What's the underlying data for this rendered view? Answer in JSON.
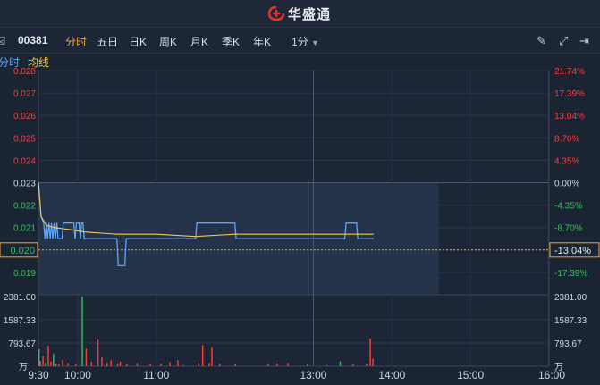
{
  "brand": {
    "name": "华盛通"
  },
  "toolbar": {
    "code": "00381",
    "tabs": [
      "分时",
      "五日",
      "日K",
      "周K",
      "月K",
      "季K",
      "年K"
    ],
    "active_tab": "分时",
    "interval": "1分"
  },
  "legend": {
    "minute": "分时",
    "avg": "均线"
  },
  "colors": {
    "up": "#ff3d3d",
    "down": "#2ec55a",
    "price_line": "#5aa6ff",
    "avg_line": "#f2c94c",
    "accent": "#f2a53b"
  },
  "price_axis": {
    "left_up": [
      "0.028",
      "0.027",
      "0.026",
      "0.025",
      "0.024"
    ],
    "left_ref": "0.023",
    "left_down": [
      "0.022",
      "0.021",
      "0.020",
      "0.019"
    ],
    "right_up": [
      "21.74%",
      "17.39%",
      "13.04%",
      "8.70%",
      "4.35%"
    ],
    "right_ref": "0.00%",
    "right_down": [
      "-4.35%",
      "-8.70%",
      "-13.04%",
      "-17.39%"
    ],
    "current_price": "0.020",
    "current_pct": "-13.04%"
  },
  "volume_axis": {
    "labels": [
      "2381.00",
      "1587.33",
      "793.67"
    ],
    "unit": "万"
  },
  "time_axis": {
    "labels": [
      "9:30",
      "10:00",
      "11:00",
      "13:00",
      "14:00",
      "15:00",
      "16:00"
    ]
  },
  "chart_data": {
    "type": "line",
    "session_minutes": 390,
    "current_minute": 306,
    "price_ylim": [
      0.018,
      0.028
    ],
    "ref_price": 0.023,
    "price": [
      [
        0,
        0.023
      ],
      [
        1,
        0.0223
      ],
      [
        2,
        0.0215
      ],
      [
        4,
        0.0212
      ],
      [
        5,
        0.0205
      ],
      [
        6,
        0.0212
      ],
      [
        7,
        0.0205
      ],
      [
        8,
        0.0212
      ],
      [
        9,
        0.0205
      ],
      [
        10,
        0.0212
      ],
      [
        11,
        0.0205
      ],
      [
        12,
        0.0212
      ],
      [
        13,
        0.0205
      ],
      [
        14,
        0.0212
      ],
      [
        15,
        0.0205
      ],
      [
        18,
        0.0205
      ],
      [
        19,
        0.0212
      ],
      [
        27,
        0.0212
      ],
      [
        28,
        0.0205
      ],
      [
        29,
        0.0212
      ],
      [
        31,
        0.0212
      ],
      [
        32,
        0.0205
      ],
      [
        33,
        0.0212
      ],
      [
        34,
        0.0212
      ],
      [
        35,
        0.0205
      ],
      [
        60,
        0.0205
      ],
      [
        61,
        0.0193
      ],
      [
        66,
        0.0193
      ],
      [
        67,
        0.0205
      ],
      [
        120,
        0.0205
      ],
      [
        121,
        0.0212
      ],
      [
        150,
        0.0212
      ],
      [
        151,
        0.0205
      ],
      [
        234,
        0.0205
      ],
      [
        235,
        0.0212
      ],
      [
        243,
        0.0212
      ],
      [
        244,
        0.0205
      ],
      [
        256,
        0.0205
      ]
    ],
    "avg": [
      [
        0,
        0.023
      ],
      [
        2,
        0.0215
      ],
      [
        6,
        0.0211
      ],
      [
        12,
        0.021
      ],
      [
        25,
        0.0209
      ],
      [
        35,
        0.0208
      ],
      [
        60,
        0.0207
      ],
      [
        90,
        0.0207
      ],
      [
        120,
        0.0206
      ],
      [
        150,
        0.0207
      ],
      [
        180,
        0.0207
      ],
      [
        210,
        0.0207
      ],
      [
        240,
        0.0207
      ],
      [
        256,
        0.0207
      ]
    ],
    "volume_ylim": [
      0,
      2381
    ],
    "volume": [
      [
        0,
        580,
        "down"
      ],
      [
        1,
        180,
        "up"
      ],
      [
        3,
        350,
        "up"
      ],
      [
        5,
        120,
        "down"
      ],
      [
        7,
        700,
        "up"
      ],
      [
        9,
        160,
        "up"
      ],
      [
        11,
        420,
        "down"
      ],
      [
        13,
        90,
        "up"
      ],
      [
        15,
        60,
        "up"
      ],
      [
        18,
        220,
        "up"
      ],
      [
        22,
        110,
        "up"
      ],
      [
        28,
        70,
        "up"
      ],
      [
        33,
        2381,
        "down"
      ],
      [
        36,
        600,
        "up"
      ],
      [
        40,
        150,
        "up"
      ],
      [
        45,
        900,
        "up"
      ],
      [
        48,
        300,
        "up"
      ],
      [
        52,
        120,
        "up"
      ],
      [
        55,
        200,
        "up"
      ],
      [
        60,
        90,
        "up"
      ],
      [
        62,
        160,
        "up"
      ],
      [
        67,
        70,
        "up"
      ],
      [
        75,
        110,
        "up"
      ],
      [
        85,
        70,
        "up"
      ],
      [
        93,
        80,
        "up"
      ],
      [
        100,
        140,
        "up"
      ],
      [
        106,
        210,
        "up"
      ],
      [
        110,
        40,
        "up"
      ],
      [
        122,
        100,
        "up"
      ],
      [
        125,
        720,
        "up"
      ],
      [
        130,
        120,
        "up"
      ],
      [
        132,
        650,
        "up"
      ],
      [
        138,
        80,
        "up"
      ],
      [
        150,
        60,
        "up"
      ],
      [
        175,
        70,
        "up"
      ],
      [
        182,
        90,
        "up"
      ],
      [
        190,
        120,
        "up"
      ],
      [
        205,
        50,
        "down"
      ],
      [
        220,
        30,
        "up"
      ],
      [
        230,
        160,
        "down"
      ],
      [
        240,
        60,
        "up"
      ],
      [
        250,
        80,
        "up"
      ],
      [
        253,
        950,
        "up"
      ],
      [
        255,
        260,
        "up"
      ]
    ]
  }
}
